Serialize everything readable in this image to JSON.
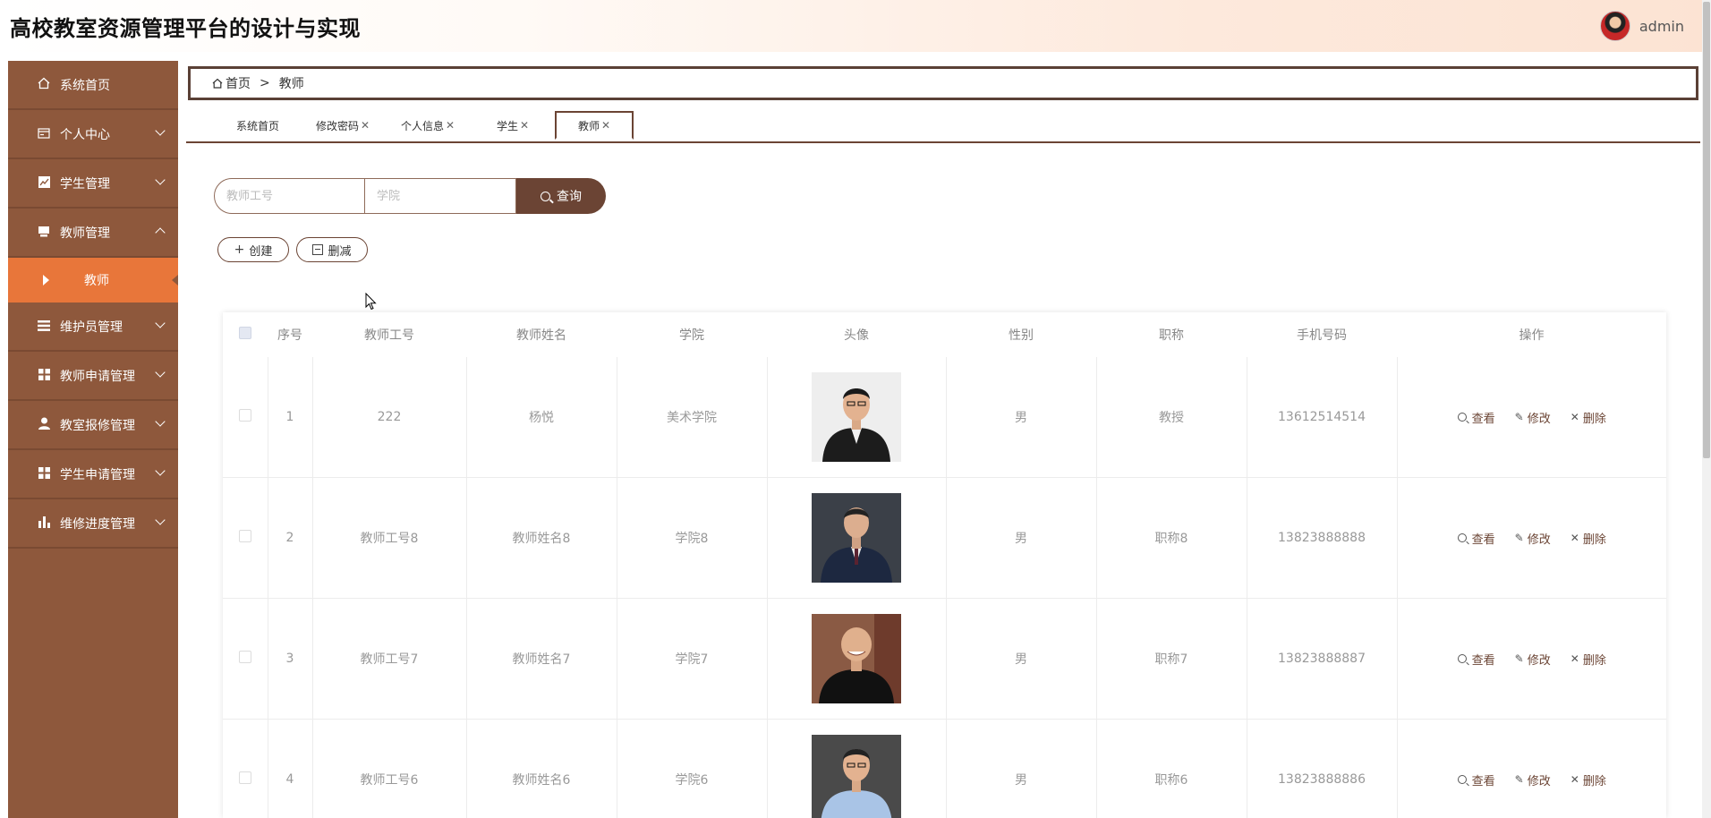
{
  "header": {
    "title": "高校教室资源管理平台的设计与实现",
    "username": "admin"
  },
  "sidebar": {
    "items": [
      {
        "label": "系统首页",
        "icon": "home-icon"
      },
      {
        "label": "个人中心",
        "icon": "card-icon"
      },
      {
        "label": "学生管理",
        "icon": "chart-icon"
      },
      {
        "label": "教师管理",
        "icon": "printer-icon"
      },
      {
        "label": "维护员管理",
        "icon": "list-icon"
      },
      {
        "label": "教师申请管理",
        "icon": "grid-icon"
      },
      {
        "label": "教室报修管理",
        "icon": "user-icon"
      },
      {
        "label": "学生申请管理",
        "icon": "grid-icon"
      },
      {
        "label": "维修进度管理",
        "icon": "bar-chart-icon"
      }
    ],
    "active_sub": "教师"
  },
  "breadcrumb": {
    "home": "首页",
    "separator": ">",
    "current": "教师"
  },
  "tabs": [
    {
      "label": "系统首页",
      "closable": false
    },
    {
      "label": "修改密码",
      "closable": true
    },
    {
      "label": "个人信息",
      "closable": true
    },
    {
      "label": "学生",
      "closable": true
    },
    {
      "label": "教师",
      "closable": true,
      "active": true
    }
  ],
  "search": {
    "placeholder_id": "教师工号",
    "placeholder_college": "学院",
    "button": "查询"
  },
  "actions": {
    "create": "创建",
    "delete": "删减"
  },
  "table": {
    "headers": [
      "序号",
      "教师工号",
      "教师姓名",
      "学院",
      "头像",
      "性别",
      "职称",
      "手机号码",
      "操作"
    ],
    "rows": [
      {
        "no": "1",
        "id": "222",
        "name": "杨悦",
        "college": "美术学院",
        "gender": "男",
        "title": "教授",
        "phone": "13612514514"
      },
      {
        "no": "2",
        "id": "教师工号8",
        "name": "教师姓名8",
        "college": "学院8",
        "gender": "男",
        "title": "职称8",
        "phone": "13823888888"
      },
      {
        "no": "3",
        "id": "教师工号7",
        "name": "教师姓名7",
        "college": "学院7",
        "gender": "男",
        "title": "职称7",
        "phone": "13823888887"
      },
      {
        "no": "4",
        "id": "教师工号6",
        "name": "教师姓名6",
        "college": "学院6",
        "gender": "男",
        "title": "职称6",
        "phone": "13823888886"
      }
    ],
    "ops": {
      "view": "查看",
      "edit": "修改",
      "delete": "删除"
    }
  },
  "colors": {
    "sidebar": "#8e583c",
    "active": "#e8763a",
    "dark_brown": "#6b4434"
  }
}
